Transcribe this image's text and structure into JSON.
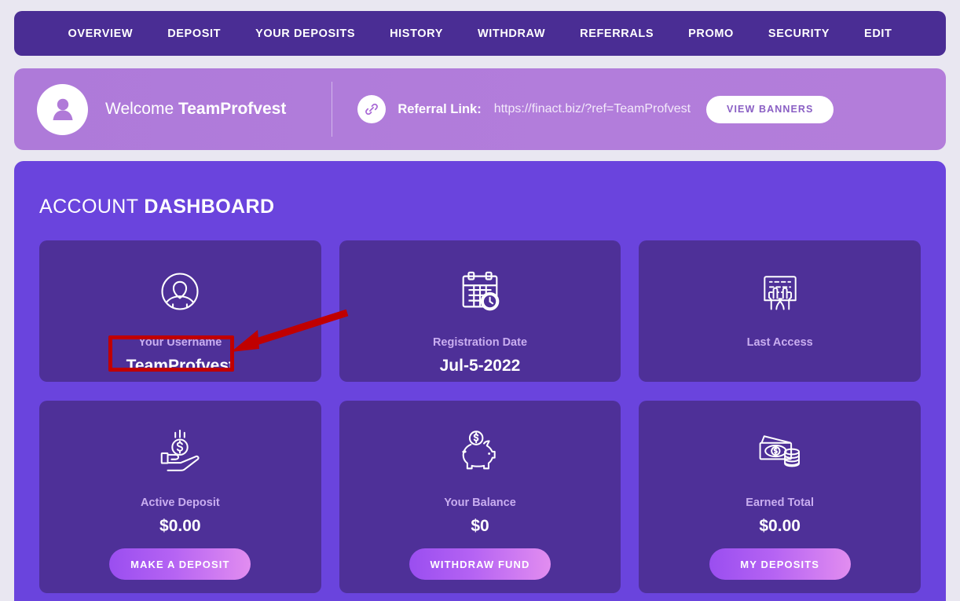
{
  "nav": {
    "items": [
      {
        "label": "OVERVIEW",
        "name": "nav-item-overview"
      },
      {
        "label": "DEPOSIT",
        "name": "nav-item-deposit"
      },
      {
        "label": "YOUR DEPOSITS",
        "name": "nav-item-your-deposits"
      },
      {
        "label": "HISTORY",
        "name": "nav-item-history"
      },
      {
        "label": "WITHDRAW",
        "name": "nav-item-withdraw"
      },
      {
        "label": "REFERRALS",
        "name": "nav-item-referrals"
      },
      {
        "label": "PROMO",
        "name": "nav-item-promo"
      },
      {
        "label": "SECURITY",
        "name": "nav-item-security"
      },
      {
        "label": "EDIT",
        "name": "nav-item-edit"
      }
    ]
  },
  "welcome": {
    "greeting": "Welcome ",
    "username": "TeamProfvest",
    "avatar_icon": "user-avatar-icon",
    "referral_icon": "chain-link-icon",
    "referral_label": "Referral Link:",
    "referral_url": "https://finact.biz/?ref=TeamProfvest",
    "view_banners_label": "VIEW BANNERS"
  },
  "dashboard": {
    "title_light": "ACCOUNT ",
    "title_bold": "DASHBOARD",
    "cards_top": [
      {
        "icon": "user-profile-circle-icon",
        "label": "Your Username",
        "value": "TeamProfvest",
        "name": "card-your-username"
      },
      {
        "icon": "calendar-clock-icon",
        "label": "Registration Date",
        "value": "Jul-5-2022",
        "name": "card-registration-date"
      },
      {
        "icon": "keyboard-hands-icon",
        "label": "Last Access",
        "value": "",
        "name": "card-last-access"
      }
    ],
    "cards_bottom": [
      {
        "icon": "hand-coin-icon",
        "label": "Active Deposit",
        "value": "$0.00",
        "button": "MAKE A DEPOSIT",
        "name": "card-active-deposit"
      },
      {
        "icon": "piggy-bank-icon",
        "label": "Your Balance",
        "value": "$0",
        "button": "WITHDRAW FUND",
        "name": "card-your-balance"
      },
      {
        "icon": "money-coins-icon",
        "label": "Earned Total",
        "value": "$0.00",
        "button": "MY DEPOSITS",
        "name": "card-earned-total"
      }
    ]
  },
  "annotation": {
    "highlight_color": "#c00000",
    "target": "TeamProfvest"
  },
  "colors": {
    "page_background": "#e9e7f1",
    "navbar": "#4a2d94",
    "welcome_bar": "#b07ad8",
    "panel": "#6a44dd",
    "card": "#4e3098",
    "card_label": "#c9aef0",
    "button_gradient_start": "#9a4ef0",
    "button_gradient_end": "#e28df0",
    "annotation_red": "#c00000"
  }
}
